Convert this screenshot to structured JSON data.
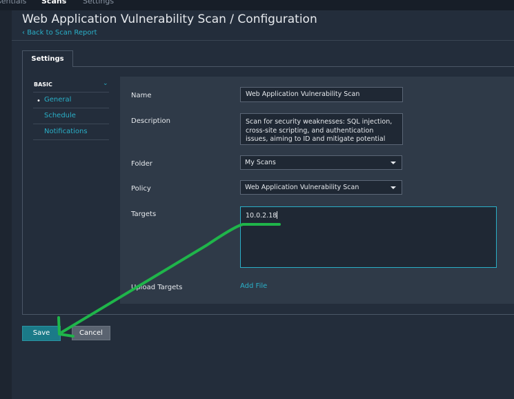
{
  "topnav": {
    "left_label": "sentials",
    "active_label": "Scans",
    "settings_label": "Settings"
  },
  "header": {
    "title": "Web Application Vulnerability Scan / Configuration",
    "back_link": "Back to Scan Report"
  },
  "tabs": {
    "settings_label": "Settings"
  },
  "sidebar": {
    "section_label": "BASIC",
    "items": [
      {
        "label": "General",
        "selected": true
      },
      {
        "label": "Schedule"
      },
      {
        "label": "Notifications"
      }
    ]
  },
  "form": {
    "name": {
      "label": "Name",
      "value": "Web Application Vulnerability Scan"
    },
    "description": {
      "label": "Description",
      "value": "Scan for security weaknesses: SQL injection, cross-site scripting, and authentication issues, aiming to ID and mitigate potential threats to"
    },
    "folder": {
      "label": "Folder",
      "value": "My Scans"
    },
    "policy": {
      "label": "Policy",
      "value": "Web Application Vulnerability Scan"
    },
    "targets": {
      "label": "Targets",
      "value": "10.0.2.18"
    },
    "upload": {
      "label": "Upload Targets",
      "link": "Add File"
    }
  },
  "buttons": {
    "save": "Save",
    "cancel": "Cancel"
  },
  "colors": {
    "accent": "#2ab0c8",
    "annotation_arrow": "#1fb54a",
    "save_button": "#1b7a88"
  }
}
